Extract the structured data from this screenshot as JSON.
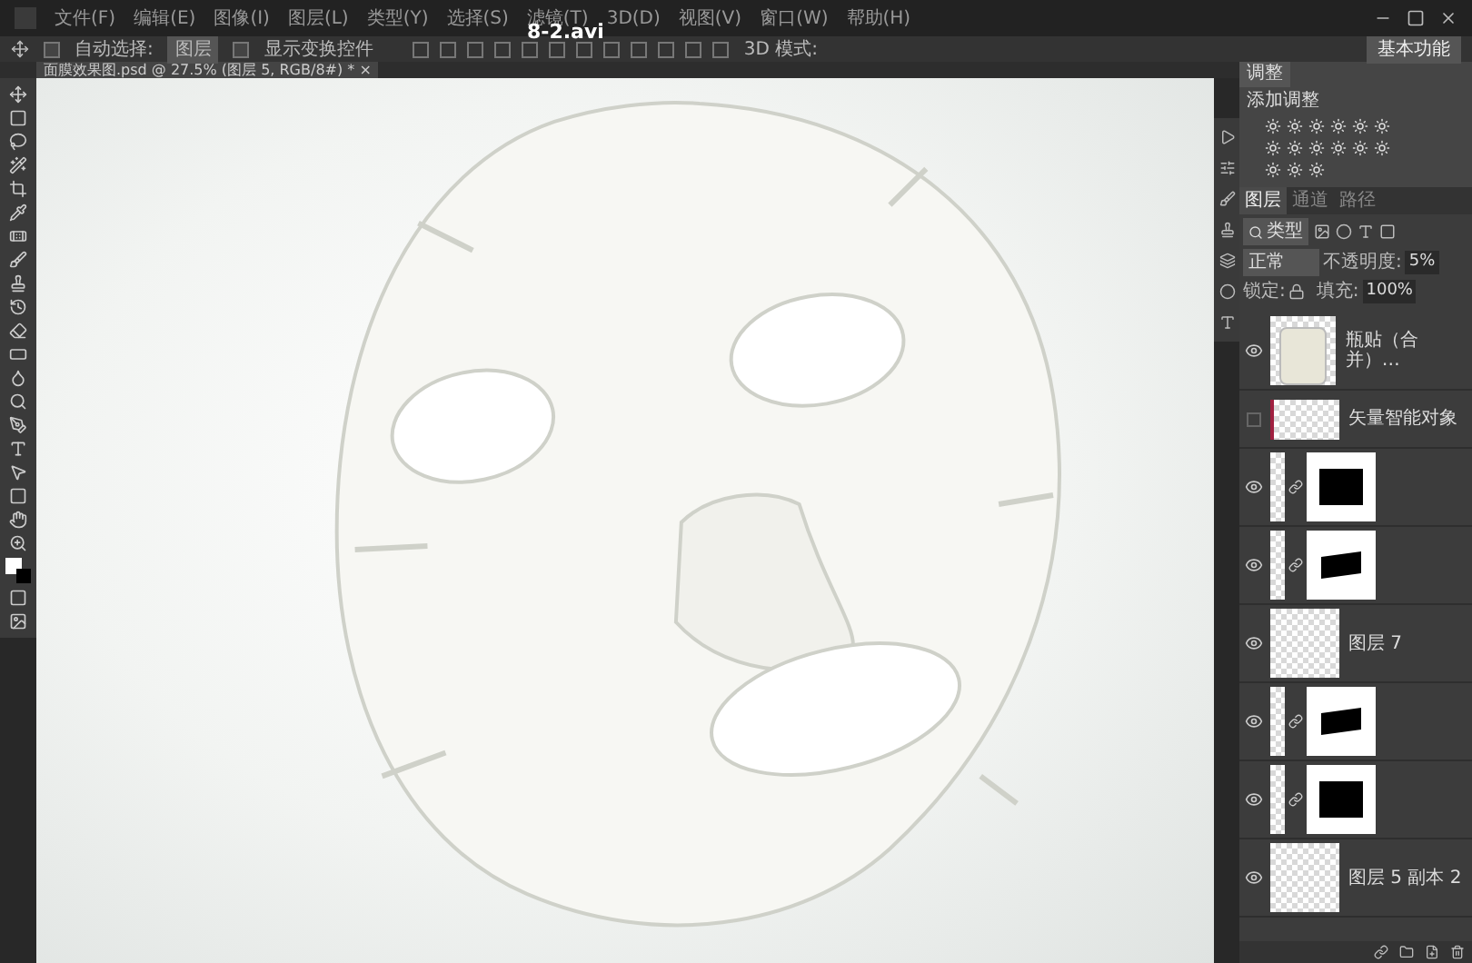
{
  "video_title": "8-2.avi",
  "menu": [
    "文件(F)",
    "编辑(E)",
    "图像(I)",
    "图层(L)",
    "类型(Y)",
    "选择(S)",
    "滤镜(T)",
    "3D(D)",
    "视图(V)",
    "窗口(W)",
    "帮助(H)"
  ],
  "options_bar": {
    "auto_select": {
      "label": "自动选择:",
      "checked": false,
      "value": "图层"
    },
    "show_transform": {
      "label": "显示变换控件",
      "checked": false
    },
    "mode_3d": "3D 模式:",
    "workspace": "基本功能"
  },
  "document_tab": {
    "title": "面膜效果图.psd @ 27.5% (图层 5, RGB/8#) *",
    "close": "×"
  },
  "adjustments_panel": {
    "tab": "调整",
    "heading": "添加调整"
  },
  "layers_panel": {
    "tabs": [
      {
        "label": "图层",
        "selected": true
      },
      {
        "label": "通道",
        "selected": false
      },
      {
        "label": "路径",
        "selected": false
      }
    ],
    "filter": "类型",
    "blend_mode": "正常",
    "opacity_label": "不透明度:",
    "opacity": "5%",
    "lock_label": "锁定:",
    "fill_label": "填充:",
    "fill": "100%",
    "layers": [
      {
        "kind": "smart",
        "name": "瓶贴（合并）…",
        "visible": true
      },
      {
        "kind": "vector",
        "name": "矢量智能对象",
        "visible": false
      },
      {
        "kind": "masked",
        "visible": true
      },
      {
        "kind": "masked",
        "visible": true
      },
      {
        "kind": "pixel",
        "name": "图层 7",
        "visible": true
      },
      {
        "kind": "masked",
        "visible": true
      },
      {
        "kind": "masked",
        "visible": true
      },
      {
        "kind": "pixel",
        "name": "图层 5 副本 2",
        "visible": true
      }
    ]
  }
}
